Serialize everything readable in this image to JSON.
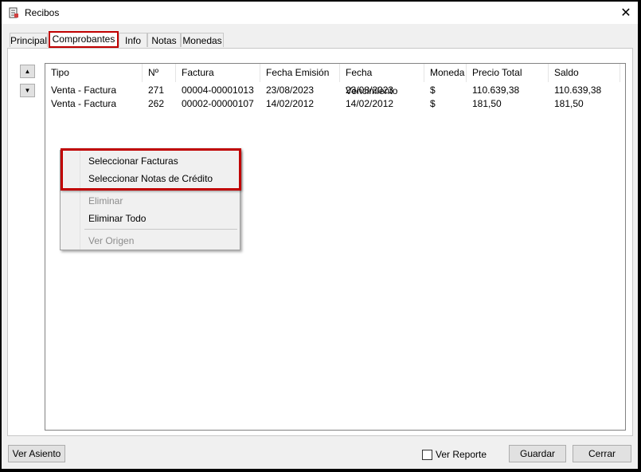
{
  "window": {
    "title": "Recibos",
    "close_glyph": "✕"
  },
  "tabs": [
    {
      "label": "Principal"
    },
    {
      "label": "Comprobantes"
    },
    {
      "label": "Info"
    },
    {
      "label": "Notas"
    },
    {
      "label": "Monedas"
    }
  ],
  "active_tab": "Comprobantes",
  "move_buttons": {
    "up": "▲",
    "down": "▼"
  },
  "grid": {
    "columns": [
      "Tipo",
      "Nº",
      "Factura",
      "Fecha Emisión",
      "Fecha Vencimiento",
      "Moneda",
      "Precio Total",
      "Saldo"
    ],
    "rows": [
      [
        "Venta - Factura",
        "271",
        "00004-00001013",
        "23/08/2023",
        "23/08/2023",
        "$",
        "110.639,38",
        "110.639,38"
      ],
      [
        "Venta - Factura",
        "262",
        "00002-00000107",
        "14/02/2012",
        "14/02/2012",
        "$",
        "181,50",
        "181,50"
      ]
    ]
  },
  "context_menu": {
    "items": [
      {
        "label": "Seleccionar Facturas",
        "enabled": true
      },
      {
        "label": "Seleccionar Notas de Crédito",
        "enabled": true
      },
      {
        "label": "Eliminar",
        "enabled": false
      },
      {
        "label": "Eliminar Todo",
        "enabled": true
      },
      {
        "label": "Ver Origen",
        "enabled": false
      }
    ]
  },
  "footer": {
    "ver_asiento": "Ver Asiento",
    "ver_reporte": "Ver Reporte",
    "ver_reporte_checked": false,
    "guardar": "Guardar",
    "cerrar": "Cerrar"
  },
  "colors": {
    "highlight": "#c00000",
    "window_bg": "#f0f0f0",
    "disabled_text": "#8c8c8c"
  }
}
